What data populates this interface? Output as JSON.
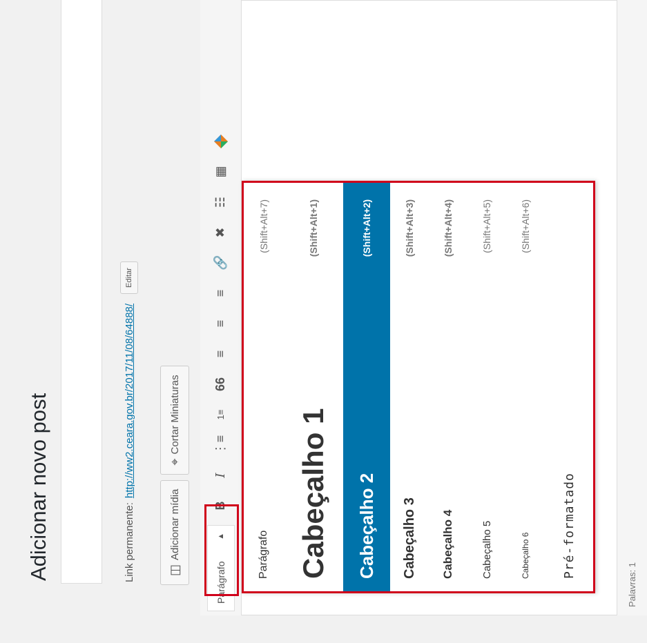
{
  "page": {
    "title": "Adicionar novo post"
  },
  "permalink": {
    "label": "Link permanente:",
    "url": "http://ww2.ceara.gov.br/2017/11/08/64888/",
    "edit_label": "Editar"
  },
  "media": {
    "add_media_label": "Adicionar mídia",
    "crop_thumbnails_label": "Cortar Miniaturas"
  },
  "toolbar": {
    "format_selected": "Parágrafo",
    "icons": [
      "bold-icon",
      "italic-icon",
      "bulleted-list-icon",
      "numbered-list-icon",
      "blockquote-icon",
      "align-left-icon",
      "align-center-icon",
      "align-right-icon",
      "link-icon",
      "unlink-icon",
      "read-more-icon",
      "toolbar-toggle-icon",
      "plugin-icon"
    ],
    "bold_glyph": "B",
    "italic_glyph": "I",
    "quote_glyph": "66"
  },
  "format_menu": {
    "items": [
      {
        "label": "Parágrafo",
        "shortcut": "(Shift+Alt+7)"
      },
      {
        "label": "Cabeçalho 1",
        "shortcut": "(Shift+Alt+1)"
      },
      {
        "label": "Cabeçalho 2",
        "shortcut": "(Shift+Alt+2)",
        "selected": true
      },
      {
        "label": "Cabeçalho 3",
        "shortcut": "(Shift+Alt+3)"
      },
      {
        "label": "Cabeçalho 4",
        "shortcut": "(Shift+Alt+4)"
      },
      {
        "label": "Cabeçalho 5",
        "shortcut": "(Shift+Alt+5)"
      },
      {
        "label": "Cabeçalho 6",
        "shortcut": "(Shift+Alt+6)"
      },
      {
        "label": "Pré-formatado",
        "shortcut": ""
      }
    ]
  },
  "status": {
    "words": "Palavras: 1"
  },
  "colors": {
    "highlight": "#d0021b",
    "selected_bg": "#0073aa",
    "link": "#0073aa"
  }
}
